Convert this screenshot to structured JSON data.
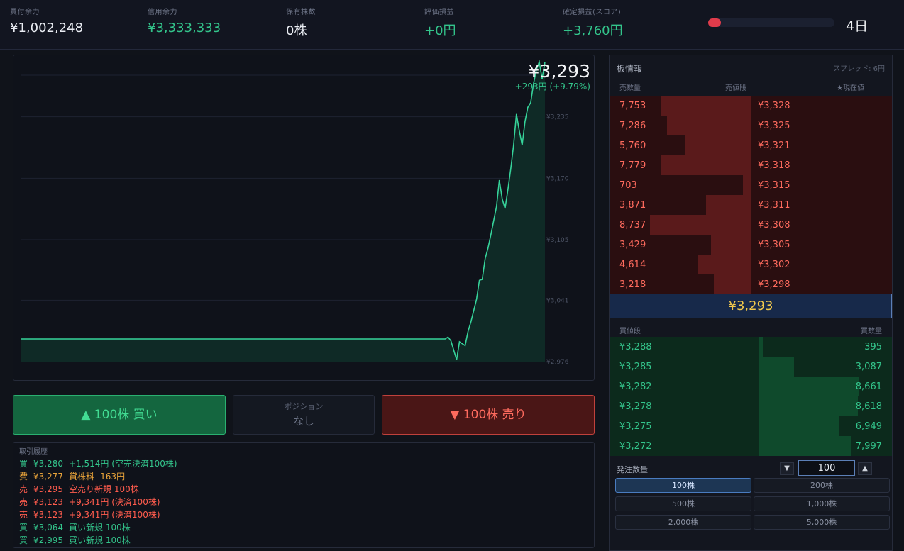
{
  "header": {
    "cash_label": "買付余力",
    "cash_value": "¥1,002,248",
    "credit_label": "信用余力",
    "credit_value": "¥3,333,333",
    "shares_label": "保有株数",
    "shares_value": "0株",
    "unrealized_label": "評価損益",
    "unrealized_value": "+0円",
    "realized_label": "確定損益(スコア)",
    "realized_value": "+3,760円",
    "progress_fraction": 0.1,
    "day": "4日"
  },
  "chart_data": {
    "type": "area",
    "price_label": "¥3,293",
    "change_label": "+293円 (+9.79%)",
    "y_ticks": [
      "¥3,235",
      "¥3,170",
      "¥3,105",
      "¥3,041",
      "¥2,976"
    ],
    "y_tick_values": [
      3235,
      3170,
      3105,
      3041,
      2976
    ],
    "ylim": [
      2976,
      3300
    ],
    "grid": true,
    "values": [
      3000,
      3000,
      3000,
      3000,
      3000,
      3000,
      3000,
      3000,
      3000,
      3000,
      3000,
      3000,
      3000,
      3000,
      3000,
      3000,
      3000,
      3000,
      3000,
      3000,
      3000,
      3000,
      3000,
      3000,
      3000,
      3000,
      3000,
      3000,
      3000,
      3000,
      3000,
      3000,
      3000,
      3000,
      3000,
      3000,
      3000,
      3000,
      3000,
      3000,
      3000,
      3000,
      3000,
      3000,
      3000,
      3000,
      3000,
      3000,
      3000,
      3000,
      3000,
      3000,
      3000,
      3000,
      3000,
      3000,
      3000,
      3000,
      3000,
      3000,
      3000,
      3000,
      3000,
      3000,
      3000,
      3000,
      3000,
      3000,
      3000,
      3000,
      3000,
      3000,
      3000,
      3000,
      3000,
      3000,
      3000,
      3000,
      3000,
      3000,
      3000,
      3000,
      3000,
      3000,
      3000,
      3000,
      3000,
      3000,
      3000,
      3000,
      3000,
      3000,
      3000,
      3000,
      3000,
      3000,
      3000,
      3000,
      3000,
      3000,
      3000,
      3000,
      3000,
      3000,
      3000,
      3000,
      3000,
      3000,
      3000,
      3000,
      3000,
      3000,
      3000,
      3000,
      3000,
      3000,
      3000,
      3000,
      3000,
      3000,
      3000,
      3000,
      3000,
      3000,
      3000,
      3000,
      3000,
      3000,
      3000,
      3000,
      3000,
      3000,
      3000,
      3000,
      3000,
      3000,
      3000,
      3000,
      3000,
      3000,
      3000,
      3000,
      3000,
      3000,
      3000,
      3000,
      3000,
      3000,
      3000,
      3000,
      3002,
      2998,
      2988,
      2978,
      2997,
      2995,
      2993,
      3008,
      3018,
      3030,
      3042,
      3062,
      3063,
      3085,
      3096,
      3110,
      3125,
      3140,
      3168,
      3148,
      3138,
      3158,
      3180,
      3205,
      3238,
      3220,
      3205,
      3230,
      3245,
      3250,
      3270,
      3285,
      3293,
      3275,
      3293
    ]
  },
  "actions": {
    "buy_label": "▲ 100株 買い",
    "position_label": "ポジション",
    "position_value": "なし",
    "sell_label": "▼ 100株 売り"
  },
  "history": {
    "title": "取引履歴",
    "rows": [
      {
        "side": "買",
        "price": "¥3,280",
        "detail": "+1,514円 (空売決済100株)",
        "color": "#33c48b"
      },
      {
        "side": "費",
        "price": "¥3,277",
        "detail": "貸株料 -163円",
        "color": "#e8a33a"
      },
      {
        "side": "売",
        "price": "¥3,295",
        "detail": "空売り新規 100株",
        "color": "#ff5c4d"
      },
      {
        "side": "売",
        "price": "¥3,123",
        "detail": "+9,341円 (決済100株)",
        "color": "#ff5c4d"
      },
      {
        "side": "売",
        "price": "¥3,123",
        "detail": "+9,341円 (決済100株)",
        "color": "#ff5c4d"
      },
      {
        "side": "買",
        "price": "¥3,064",
        "detail": "買い新規 100株",
        "color": "#33c48b"
      },
      {
        "side": "買",
        "price": "¥2,995",
        "detail": "買い新規 100株",
        "color": "#33c48b"
      }
    ]
  },
  "book": {
    "title": "板情報",
    "spread": "スプレッド: 6円",
    "ask_qty_header": "売数量",
    "ask_price_header": "売値段",
    "current_header": "★現在値",
    "bid_price_header": "買値段",
    "bid_qty_header": "買数量",
    "asks": [
      {
        "qty": "7,753",
        "price": "¥3,328",
        "depth": 7753
      },
      {
        "qty": "7,286",
        "price": "¥3,325",
        "depth": 7286
      },
      {
        "qty": "5,760",
        "price": "¥3,321",
        "depth": 5760
      },
      {
        "qty": "7,779",
        "price": "¥3,318",
        "depth": 7779
      },
      {
        "qty": "703",
        "price": "¥3,315",
        "depth": 703
      },
      {
        "qty": "3,871",
        "price": "¥3,311",
        "depth": 3871
      },
      {
        "qty": "8,737",
        "price": "¥3,308",
        "depth": 8737
      },
      {
        "qty": "3,429",
        "price": "¥3,305",
        "depth": 3429
      },
      {
        "qty": "4,614",
        "price": "¥3,302",
        "depth": 4614
      },
      {
        "qty": "3,218",
        "price": "¥3,298",
        "depth": 3218
      }
    ],
    "current_price": "¥3,293",
    "bids": [
      {
        "price": "¥3,288",
        "qty": "395",
        "depth": 395
      },
      {
        "price": "¥3,285",
        "qty": "3,087",
        "depth": 3087
      },
      {
        "price": "¥3,282",
        "qty": "8,661",
        "depth": 8661
      },
      {
        "price": "¥3,278",
        "qty": "8,618",
        "depth": 8618
      },
      {
        "price": "¥3,275",
        "qty": "6,949",
        "depth": 6949
      },
      {
        "price": "¥3,272",
        "qty": "7,997",
        "depth": 7997
      }
    ]
  },
  "order": {
    "qty_label": "発注数量",
    "qty_value": "100",
    "down_label": "▼",
    "up_label": "▲",
    "presets": [
      "100株",
      "200株",
      "500株",
      "1,000株",
      "2,000株",
      "5,000株"
    ],
    "selected": "100株"
  }
}
